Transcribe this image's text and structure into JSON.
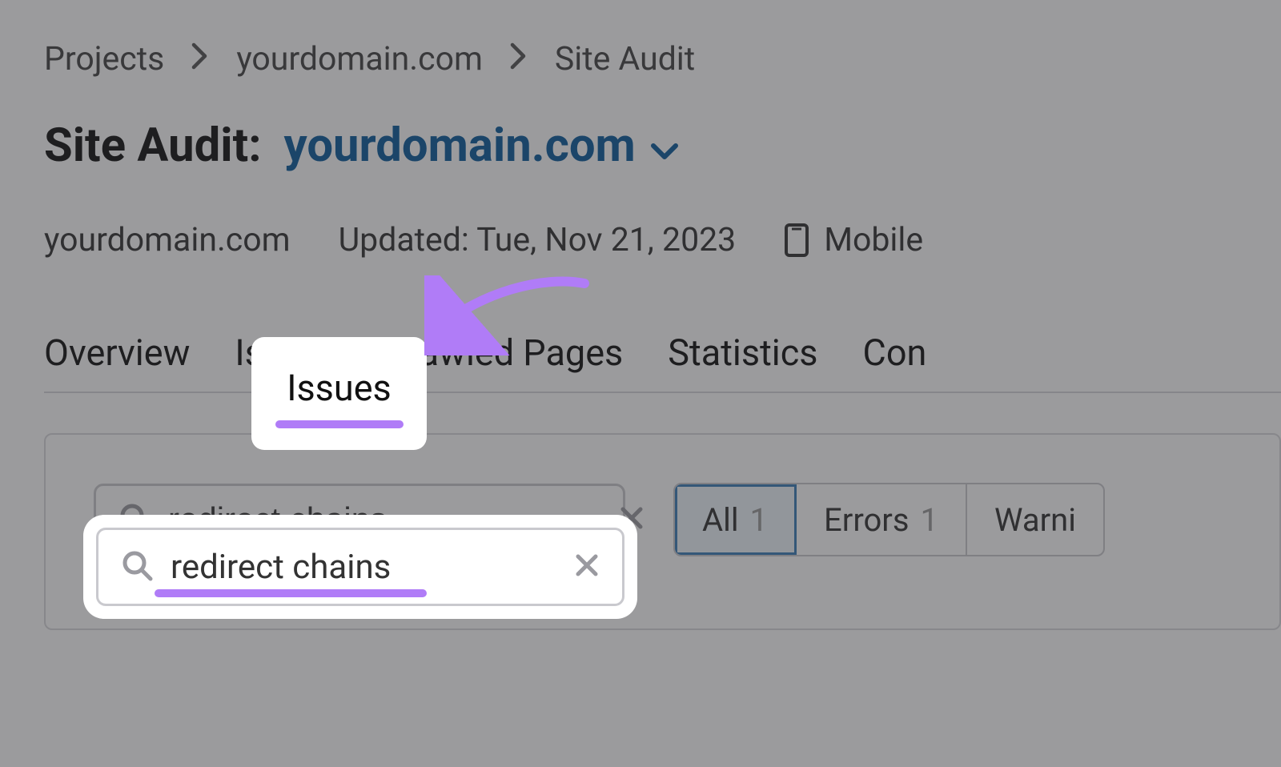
{
  "breadcrumb": {
    "projects": "Projects",
    "domain": "yourdomain.com",
    "section": "Site Audit"
  },
  "title": {
    "label": "Site Audit:",
    "domain": "yourdomain.com"
  },
  "meta": {
    "domain": "yourdomain.com",
    "updated": "Updated: Tue, Nov 21, 2023",
    "device": "Mobile"
  },
  "tabs": {
    "overview": "Overview",
    "issues": "Issues",
    "crawled": "Crawled Pages",
    "statistics": "Statistics",
    "compared": "Con"
  },
  "search": {
    "value": "redirect chains"
  },
  "filters": {
    "all_label": "All",
    "all_count": "1",
    "errors_label": "Errors",
    "errors_count": "1",
    "warnings_label": "Warni"
  },
  "colors": {
    "accent": "#b07cf7",
    "link": "#0b5b9c"
  }
}
